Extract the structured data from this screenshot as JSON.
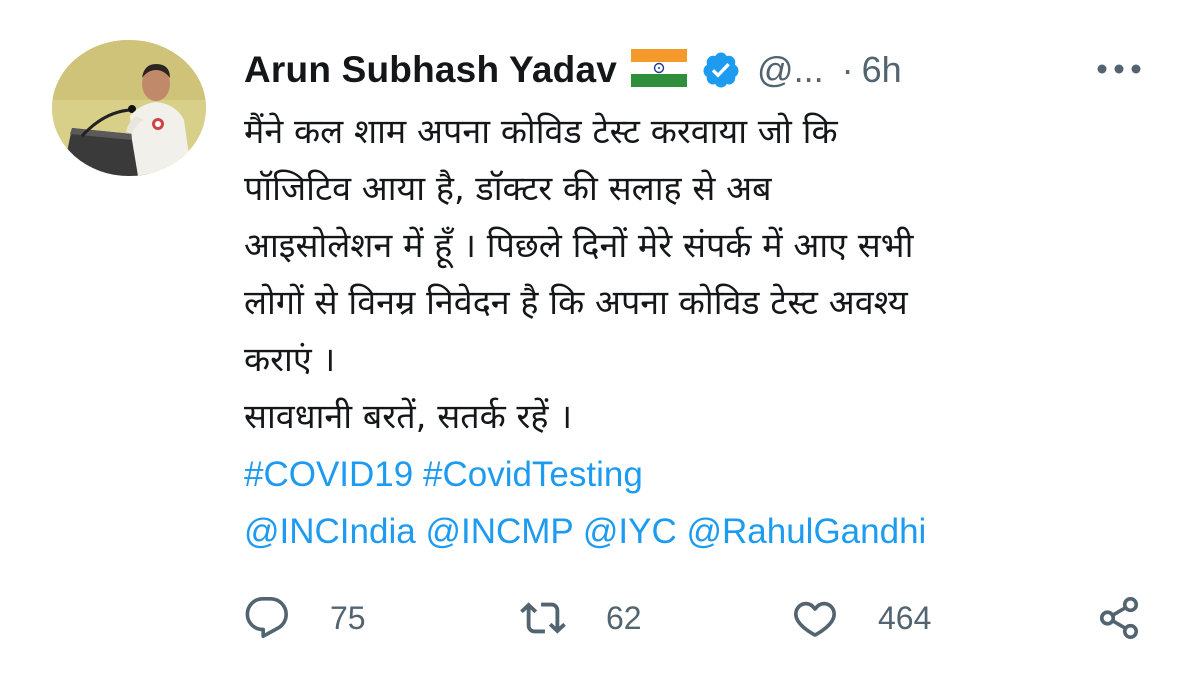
{
  "tweet": {
    "author_name": "Arun Subhash Yadav",
    "handle": "@...",
    "separator": "·",
    "time": "6h",
    "icons": {
      "flag": "india-flag-icon",
      "verified": "verified-badge-icon",
      "more": "more-options-icon"
    },
    "text_lines": [
      "मैंने कल शाम अपना कोविड टेस्ट करवाया जो कि",
      "पॉजिटिव आया है, डॉक्टर की सलाह से अब",
      "आइसोलेशन में हूँ । पिछले दिनों मेरे संपर्क में आए सभी",
      "लोगों से विनम्र निवेदन है कि अपना कोविड टेस्ट अवश्य",
      "कराएं ।",
      "सावधानी बरतें, सतर्क रहें ।"
    ],
    "hashtags": [
      "#COVID19",
      "#CovidTesting"
    ],
    "mentions": [
      "@INCIndia",
      "@INCMP",
      "@IYC",
      "@RahulGandhi"
    ],
    "actions": {
      "reply": {
        "icon": "reply-icon",
        "count": "75"
      },
      "retweet": {
        "icon": "retweet-icon",
        "count": "62"
      },
      "like": {
        "icon": "heart-icon",
        "count": "464"
      },
      "share": {
        "icon": "share-icon"
      }
    },
    "colors": {
      "link": "#1d9bf0",
      "text": "#14171a",
      "secondary": "#536471",
      "verified": "#1d9bf0"
    }
  }
}
